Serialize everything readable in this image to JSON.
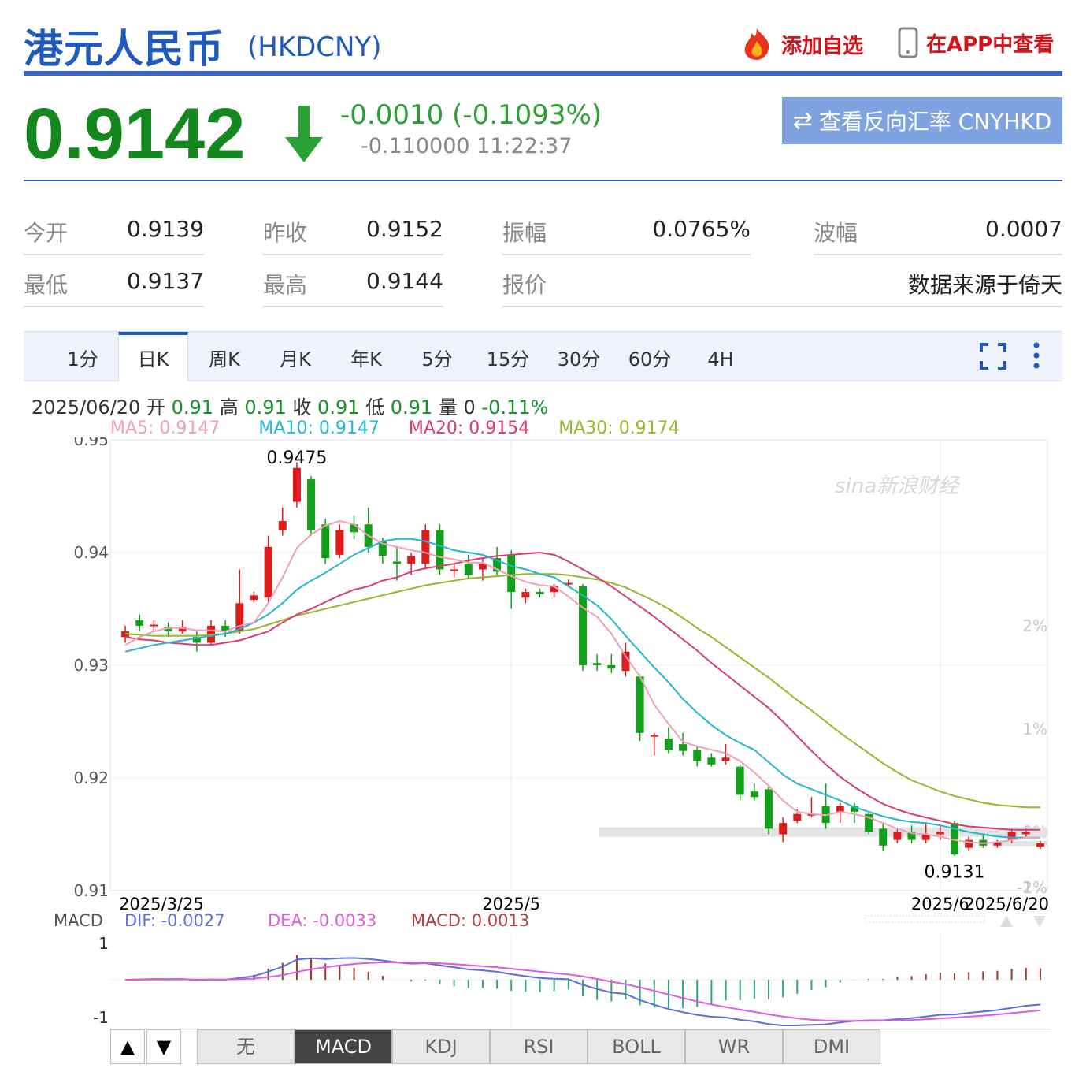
{
  "header": {
    "title": "港元人民币",
    "code": "(HKDCNY)",
    "add_favorite": "添加自选",
    "view_in_app": "在APP中查看"
  },
  "quote": {
    "price": "0.9142",
    "change": "-0.0010 (-0.1093%)",
    "change2": "-0.110000 11:22:37",
    "reverse_button": "查看反向汇率 CNYHKD",
    "down_color": "#15871f"
  },
  "stats": {
    "open_label": "今开",
    "open": "0.9139",
    "prev_close_label": "昨收",
    "prev_close": "0.9152",
    "amplitude_label": "振幅",
    "amplitude": "0.0765%",
    "wave_label": "波幅",
    "wave": "0.0007",
    "low_label": "最低",
    "low": "0.9137",
    "high_label": "最高",
    "high": "0.9144",
    "quote_label": "报价",
    "source": "数据来源于倚天"
  },
  "tabs": [
    "1分",
    "日K",
    "周K",
    "月K",
    "年K",
    "5分",
    "15分",
    "30分",
    "60分",
    "4H"
  ],
  "active_tab": "日K",
  "info": {
    "date": "2025/06/20",
    "open_label": "开",
    "open": "0.91",
    "high_label": "高",
    "high": "0.91",
    "close_label": "收",
    "close": "0.91",
    "low_label": "低",
    "low": "0.91",
    "vol_label": "量",
    "vol": "0",
    "pct": "-0.11%",
    "ma5": "MA5: 0.9147",
    "ma10": "MA10: 0.9147",
    "ma20": "MA20: 0.9154",
    "ma30": "MA30: 0.9174"
  },
  "chart_data": {
    "type": "candlestick",
    "y_ticks": [
      "0.95",
      "0.94",
      "0.93",
      "0.92",
      "0.91"
    ],
    "pct_ticks": [
      "2%",
      "1%",
      "0%",
      "-1%",
      "-2%"
    ],
    "x_ticks": [
      "2025/3/25",
      "2025/5",
      "2025/6",
      "2025/6/20"
    ],
    "ylim": [
      0.91,
      0.95
    ],
    "max_label": "0.9475",
    "min_label": "0.9131",
    "prev_close": 0.9152,
    "watermark": "sina新浪财经",
    "candles": [
      [
        0.9325,
        0.933,
        0.9335,
        0.932
      ],
      [
        0.934,
        0.9335,
        0.9345,
        0.933
      ],
      [
        0.9335,
        0.9336,
        0.934,
        0.933
      ],
      [
        0.9334,
        0.933,
        0.9338,
        0.9325
      ],
      [
        0.933,
        0.9334,
        0.934,
        0.9328
      ],
      [
        0.9325,
        0.932,
        0.933,
        0.9312
      ],
      [
        0.932,
        0.9335,
        0.934,
        0.9318
      ],
      [
        0.9335,
        0.933,
        0.934,
        0.9325
      ],
      [
        0.933,
        0.9355,
        0.9385,
        0.9328
      ],
      [
        0.9358,
        0.9362,
        0.9365,
        0.9355
      ],
      [
        0.936,
        0.9405,
        0.9415,
        0.9355
      ],
      [
        0.942,
        0.9428,
        0.944,
        0.9415
      ],
      [
        0.9445,
        0.9475,
        0.948,
        0.944
      ],
      [
        0.9465,
        0.942,
        0.9468,
        0.9415
      ],
      [
        0.9425,
        0.9395,
        0.943,
        0.939
      ],
      [
        0.9398,
        0.942,
        0.9425,
        0.9395
      ],
      [
        0.9425,
        0.9418,
        0.9432,
        0.9412
      ],
      [
        0.9425,
        0.9405,
        0.944,
        0.94
      ],
      [
        0.941,
        0.9397,
        0.9413,
        0.939
      ],
      [
        0.9392,
        0.939,
        0.9405,
        0.9375
      ],
      [
        0.939,
        0.9397,
        0.94,
        0.938
      ],
      [
        0.939,
        0.942,
        0.9425,
        0.9385
      ],
      [
        0.942,
        0.9385,
        0.9425,
        0.938
      ],
      [
        0.9385,
        0.9385,
        0.939,
        0.9378
      ],
      [
        0.939,
        0.938,
        0.9398,
        0.9377
      ],
      [
        0.9385,
        0.939,
        0.9395,
        0.9375
      ],
      [
        0.9395,
        0.9383,
        0.9405,
        0.938
      ],
      [
        0.9398,
        0.9365,
        0.9402,
        0.935
      ],
      [
        0.936,
        0.9365,
        0.9368,
        0.9355
      ],
      [
        0.9365,
        0.9363,
        0.9368,
        0.936
      ],
      [
        0.9365,
        0.937,
        0.9372,
        0.936
      ],
      [
        0.9372,
        0.9373,
        0.9376,
        0.937
      ],
      [
        0.937,
        0.93,
        0.9372,
        0.9295
      ],
      [
        0.9302,
        0.93,
        0.931,
        0.9295
      ],
      [
        0.93,
        0.9297,
        0.931,
        0.9293
      ],
      [
        0.9295,
        0.9312,
        0.932,
        0.929
      ],
      [
        0.929,
        0.924,
        0.9292,
        0.9233
      ],
      [
        0.9238,
        0.9238,
        0.924,
        0.922
      ],
      [
        0.9235,
        0.9225,
        0.9245,
        0.9222
      ],
      [
        0.923,
        0.9224,
        0.924,
        0.922
      ],
      [
        0.9225,
        0.9215,
        0.9228,
        0.921
      ],
      [
        0.9218,
        0.9212,
        0.9222,
        0.921
      ],
      [
        0.9215,
        0.9218,
        0.923,
        0.9212
      ],
      [
        0.921,
        0.9185,
        0.9212,
        0.918
      ],
      [
        0.9188,
        0.9183,
        0.9195,
        0.918
      ],
      [
        0.919,
        0.9155,
        0.9192,
        0.915
      ],
      [
        0.915,
        0.916,
        0.9165,
        0.9143
      ],
      [
        0.9162,
        0.9168,
        0.9172,
        0.916
      ],
      [
        0.9168,
        0.9168,
        0.9183,
        0.9165
      ],
      [
        0.9175,
        0.916,
        0.9195,
        0.9155
      ],
      [
        0.917,
        0.9175,
        0.9178,
        0.916
      ],
      [
        0.9175,
        0.917,
        0.9178,
        0.916
      ],
      [
        0.9168,
        0.9152,
        0.917,
        0.915
      ],
      [
        0.9155,
        0.914,
        0.916,
        0.9135
      ],
      [
        0.9145,
        0.9152,
        0.9155,
        0.9142
      ],
      [
        0.9152,
        0.9145,
        0.9158,
        0.9142
      ],
      [
        0.9145,
        0.915,
        0.916,
        0.9142
      ],
      [
        0.915,
        0.9152,
        0.9158,
        0.9145
      ],
      [
        0.916,
        0.9132,
        0.9162,
        0.9131
      ],
      [
        0.9138,
        0.9145,
        0.9148,
        0.9135
      ],
      [
        0.9145,
        0.914,
        0.915,
        0.9138
      ],
      [
        0.914,
        0.9142,
        0.9145,
        0.9138
      ],
      [
        0.9145,
        0.9152,
        0.9155,
        0.9142
      ],
      [
        0.915,
        0.9152,
        0.9155,
        0.9148
      ],
      [
        0.9139,
        0.9142,
        0.9144,
        0.9137
      ]
    ],
    "ma5": [
      0.9318,
      0.9325,
      0.933,
      0.9333,
      0.9333,
      0.9331,
      0.9331,
      0.933,
      0.9335,
      0.9338,
      0.9355,
      0.9378,
      0.9404,
      0.9416,
      0.9424,
      0.9428,
      0.9425,
      0.9415,
      0.9408,
      0.9405,
      0.9402,
      0.94,
      0.9396,
      0.9394,
      0.9391,
      0.9391,
      0.9385,
      0.9379,
      0.9374,
      0.9371,
      0.937,
      0.9361,
      0.9351,
      0.9343,
      0.9328,
      0.9308,
      0.929,
      0.9265,
      0.9248,
      0.9232,
      0.9228,
      0.9225,
      0.9222,
      0.9215,
      0.9205,
      0.9193,
      0.918,
      0.917,
      0.9168,
      0.9167,
      0.917,
      0.9168,
      0.9165,
      0.916,
      0.9155,
      0.9151,
      0.915,
      0.9148,
      0.9145,
      0.9143,
      0.9142,
      0.9143,
      0.9145,
      0.9147,
      0.9147
    ],
    "ma10": [
      0.9312,
      0.9315,
      0.9318,
      0.932,
      0.9322,
      0.9324,
      0.9326,
      0.9328,
      0.9332,
      0.9338,
      0.9345,
      0.9355,
      0.9367,
      0.9375,
      0.9382,
      0.939,
      0.9398,
      0.9404,
      0.941,
      0.9412,
      0.9412,
      0.941,
      0.9406,
      0.9402,
      0.94,
      0.9398,
      0.9393,
      0.9388,
      0.9385,
      0.9381,
      0.9378,
      0.937,
      0.9362,
      0.9353,
      0.9341,
      0.9326,
      0.9312,
      0.9298,
      0.9285,
      0.927,
      0.9258,
      0.9247,
      0.9238,
      0.9231,
      0.9225,
      0.9214,
      0.9203,
      0.9195,
      0.919,
      0.9185,
      0.918,
      0.9174,
      0.917,
      0.9166,
      0.9163,
      0.9161,
      0.916,
      0.9158,
      0.9155,
      0.9152,
      0.915,
      0.9148,
      0.9147,
      0.9147,
      0.9147
    ],
    "ma20": [
      0.9325,
      0.9323,
      0.9322,
      0.932,
      0.9319,
      0.9318,
      0.9318,
      0.932,
      0.9322,
      0.9326,
      0.933,
      0.9338,
      0.9345,
      0.935,
      0.9356,
      0.9362,
      0.9367,
      0.937,
      0.9375,
      0.9378,
      0.9383,
      0.9386,
      0.9388,
      0.939,
      0.9393,
      0.9395,
      0.9397,
      0.9398,
      0.9399,
      0.94,
      0.9398,
      0.9392,
      0.9385,
      0.9378,
      0.937,
      0.9361,
      0.9352,
      0.9343,
      0.9333,
      0.9323,
      0.9313,
      0.9302,
      0.9292,
      0.9282,
      0.9272,
      0.9262,
      0.925,
      0.9237,
      0.9224,
      0.9212,
      0.9201,
      0.9192,
      0.9184,
      0.9177,
      0.9172,
      0.9168,
      0.9165,
      0.9162,
      0.9159,
      0.9157,
      0.9156,
      0.9155,
      0.9154,
      0.9154,
      0.9154
    ],
    "ma30": [
      0.9328,
      0.9327,
      0.9326,
      0.9326,
      0.9326,
      0.9326,
      0.9327,
      0.9328,
      0.933,
      0.9332,
      0.9336,
      0.934,
      0.9344,
      0.9347,
      0.935,
      0.9353,
      0.9356,
      0.9359,
      0.9362,
      0.9365,
      0.9368,
      0.9371,
      0.9373,
      0.9375,
      0.9377,
      0.9378,
      0.9379,
      0.938,
      0.9381,
      0.9381,
      0.9381,
      0.938,
      0.9378,
      0.9376,
      0.9373,
      0.9369,
      0.9363,
      0.9357,
      0.935,
      0.9342,
      0.9333,
      0.9325,
      0.9316,
      0.9307,
      0.9298,
      0.9289,
      0.9279,
      0.9269,
      0.926,
      0.925,
      0.924,
      0.9231,
      0.9222,
      0.9213,
      0.9205,
      0.9198,
      0.9193,
      0.9188,
      0.9184,
      0.9181,
      0.9178,
      0.9176,
      0.9175,
      0.9174,
      0.9174
    ],
    "macd_label": "MACD",
    "dif_label": "DIF: -0.0027",
    "dea_label": "DEA: -0.0033",
    "macd_val_label": "MACD: 0.0013",
    "macd_ticks": [
      "1",
      "-1"
    ],
    "colors": {
      "up": "#e01b1b",
      "down": "#12a01a",
      "ma5": "#f2a0b6",
      "ma10": "#21b7d0",
      "ma20": "#dc3a74",
      "ma30": "#95b82a",
      "dif": "#5a6fdc",
      "dea": "#e05ae0"
    }
  },
  "indicators": [
    "无",
    "MACD",
    "KDJ",
    "RSI",
    "BOLL",
    "WR",
    "DMI"
  ],
  "active_indicator": "MACD",
  "nav": {
    "up": "▲",
    "down": "▼"
  }
}
